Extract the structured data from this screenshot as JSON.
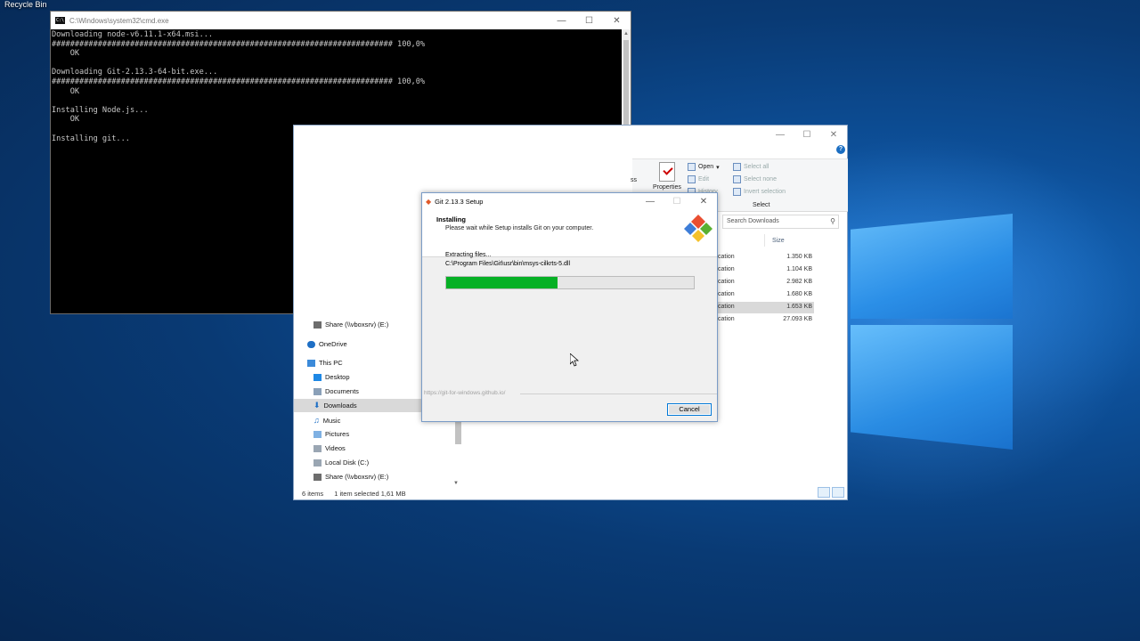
{
  "desktop": {
    "recycle_bin_label": "Recycle Bin"
  },
  "cmd": {
    "title": "C:\\Windows\\system32\\cmd.exe",
    "lines": [
      "Downloading node-v6.11.1-x64.msi...",
      "########################################################################## 100,0%",
      "    OK",
      "",
      "Downloading Git-2.13.3-64-bit.exe...",
      "########################################################################## 100,0%",
      "    OK",
      "",
      "Installing Node.js...",
      "    OK",
      "",
      "Installing git..."
    ]
  },
  "explorer": {
    "ribbon": {
      "properties_label": "Properties",
      "open_label": "Open",
      "edit_label": "Edit",
      "history_label": "History",
      "select_all_label": "Select all",
      "select_none_label": "Select none",
      "invert_selection_label": "Invert selection",
      "select_group_label": "Select",
      "partial_label": "ss"
    },
    "search_placeholder": "Search Downloads",
    "size_column": "Size",
    "files": [
      {
        "type": "cation",
        "size": "1.350 KB",
        "selected": false
      },
      {
        "type": "cation",
        "size": "1.104 KB",
        "selected": false
      },
      {
        "type": "cation",
        "size": "2.982 KB",
        "selected": false
      },
      {
        "type": "cation",
        "size": "1.680 KB",
        "selected": false
      },
      {
        "type": "cation",
        "size": "1.653 KB",
        "selected": true
      },
      {
        "type": "cation",
        "size": "27.093 KB",
        "selected": false
      }
    ],
    "nav": {
      "share_top": "Share (\\\\vboxsrv) (E:)",
      "onedrive": "OneDrive",
      "this_pc": "This PC",
      "desktop": "Desktop",
      "documents": "Documents",
      "downloads": "Downloads",
      "music": "Music",
      "pictures": "Pictures",
      "videos": "Videos",
      "local_disk": "Local Disk (C:)",
      "share_bottom": "Share (\\\\vboxsrv) (E:)"
    },
    "status_items": "6 items",
    "status_selected": "1 item selected  1,61 MB"
  },
  "git": {
    "title": "Git 2.13.3 Setup",
    "heading": "Installing",
    "subheading": "Please wait while Setup installs Git on your computer.",
    "status": "Extracting files...",
    "path": "C:\\Program Files\\Git\\usr\\bin\\msys-cilkrts-5.dll",
    "progress": 0.45,
    "url": "https://git-for-windows.github.io/",
    "cancel_label": "Cancel"
  }
}
